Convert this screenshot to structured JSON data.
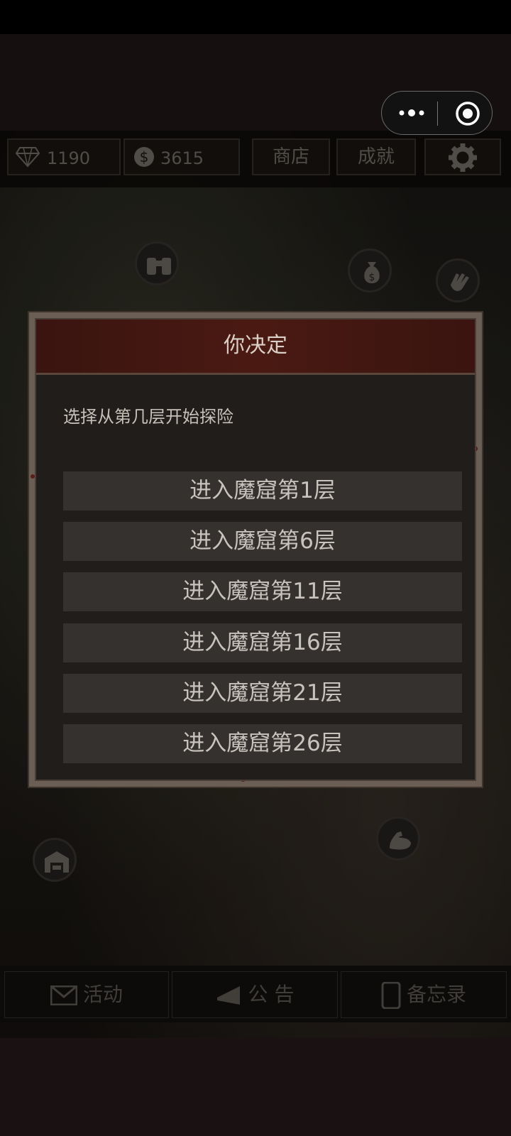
{
  "hud": {
    "diamonds": "1190",
    "coins": "3615",
    "shop_label": "商店",
    "achievements_label": "成就"
  },
  "dialog": {
    "title": "你决定",
    "description": "选择从第几层开始探险",
    "options": [
      "进入魔窟第1层",
      "进入魔窟第6层",
      "进入魔窟第11层",
      "进入魔窟第16层",
      "进入魔窟第21层",
      "进入魔窟第26层"
    ]
  },
  "bottom_nav": {
    "events_label": "活动",
    "notice_label": "公 告",
    "memo_label": "备忘录"
  },
  "colors": {
    "dialog_header": "#4a1a12",
    "dialog_body": "#211d1a",
    "option_button": "#35312e",
    "frame": "#6b5f55"
  },
  "icons": [
    "diamond-icon",
    "coin-icon",
    "gear-icon",
    "binoculars-icon",
    "money-bag-icon",
    "hand-icon",
    "muscle-icon",
    "warehouse-icon",
    "mail-icon",
    "megaphone-icon",
    "phone-icon",
    "more-icon",
    "close-icon"
  ]
}
